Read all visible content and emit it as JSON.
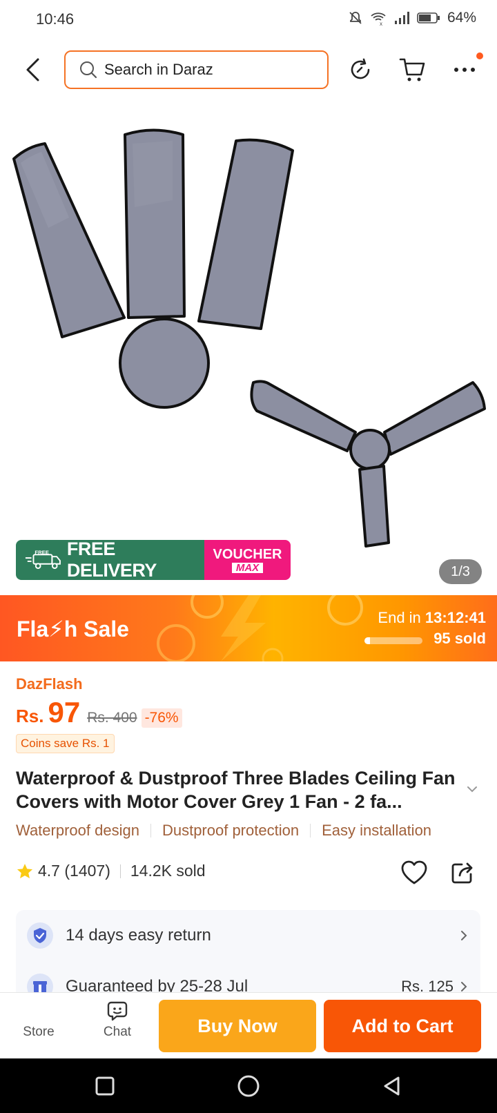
{
  "status_bar": {
    "time": "10:46",
    "battery": "64%"
  },
  "search": {
    "placeholder": "Search in Daraz"
  },
  "gallery": {
    "counter": "1/3"
  },
  "badges": {
    "free_tag": "FREE",
    "free_delivery": "FREE DELIVERY",
    "voucher_line1": "VOUCHER",
    "voucher_line2": "MAX"
  },
  "flash_sale": {
    "title": "Fla⚡h  Sale",
    "end_label": "End in",
    "end_time": "13:12:41",
    "sold": "95 sold",
    "progress": 0.1
  },
  "product": {
    "campaign": "DazFlash",
    "currency": "Rs.",
    "price": "97",
    "original_price": "Rs. 400",
    "discount": "-76%",
    "coins": "Coins save Rs. 1",
    "title": "Waterproof & Dustproof Three Blades Ceiling Fan Covers with Motor Cover Grey 1 Fan - 2 fa...",
    "features": [
      "Waterproof design",
      "Dustproof protection",
      "Easy installation"
    ],
    "rating": "4.7",
    "reviews": "(1407)",
    "sold": "14.2K sold"
  },
  "services": {
    "return": "14 days easy return",
    "delivery": "Guaranteed by 25-28 Jul",
    "delivery_fee": "Rs. 125"
  },
  "bottom_bar": {
    "store": "Store",
    "chat": "Chat",
    "buy_now": "Buy Now",
    "add_to_cart": "Add to Cart"
  },
  "colors": {
    "brand": "#f85606",
    "buy": "#faa61a",
    "delivery_green": "#2e7d5b",
    "voucher_pink": "#f0197d"
  }
}
